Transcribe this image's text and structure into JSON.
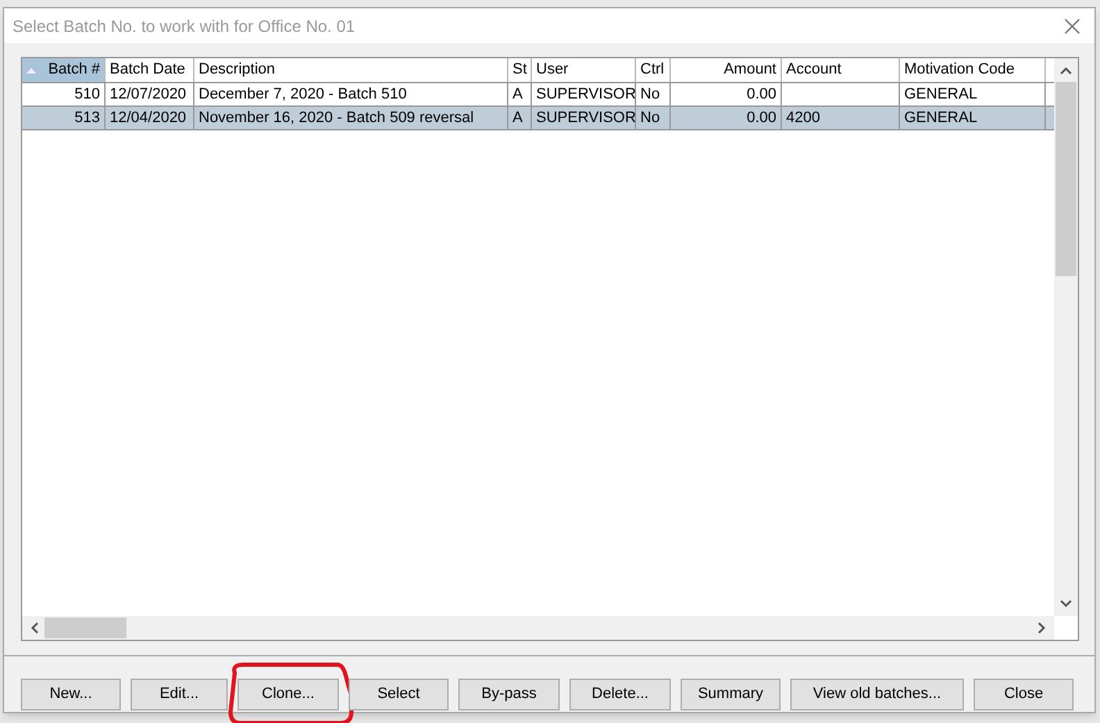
{
  "window": {
    "title": "Select Batch No. to work with for Office No. 01"
  },
  "table": {
    "columns": [
      {
        "label": "Batch #",
        "sorted": true
      },
      {
        "label": "Batch Date",
        "sorted": false
      },
      {
        "label": "Description",
        "sorted": false
      },
      {
        "label": "St",
        "sorted": false
      },
      {
        "label": "User",
        "sorted": false
      },
      {
        "label": "Ctrl",
        "sorted": false
      },
      {
        "label": "Amount",
        "sorted": false
      },
      {
        "label": "Account",
        "sorted": false
      },
      {
        "label": "Motivation Code",
        "sorted": false
      }
    ],
    "rows": [
      {
        "selected": false,
        "cells": [
          "510",
          "12/07/2020",
          "December 7, 2020 - Batch 510",
          "A",
          "SUPERVISOR",
          "No",
          "0.00",
          "",
          "GENERAL"
        ]
      },
      {
        "selected": true,
        "cells": [
          "513",
          "12/04/2020",
          "November 16, 2020 - Batch 509 reversal",
          "A",
          "SUPERVISOR",
          "No",
          "0.00",
          "4200",
          "GENERAL"
        ]
      }
    ]
  },
  "buttons": [
    {
      "label": "New...",
      "annotated": false
    },
    {
      "label": "Edit...",
      "annotated": false
    },
    {
      "label": "Clone...",
      "annotated": true
    },
    {
      "label": "Select",
      "annotated": false
    },
    {
      "label": "By-pass",
      "annotated": false
    },
    {
      "label": "Delete...",
      "annotated": false
    },
    {
      "label": "Summary",
      "annotated": false
    },
    {
      "label": "View old batches...",
      "annotated": false
    },
    {
      "label": "Close",
      "annotated": false
    }
  ]
}
